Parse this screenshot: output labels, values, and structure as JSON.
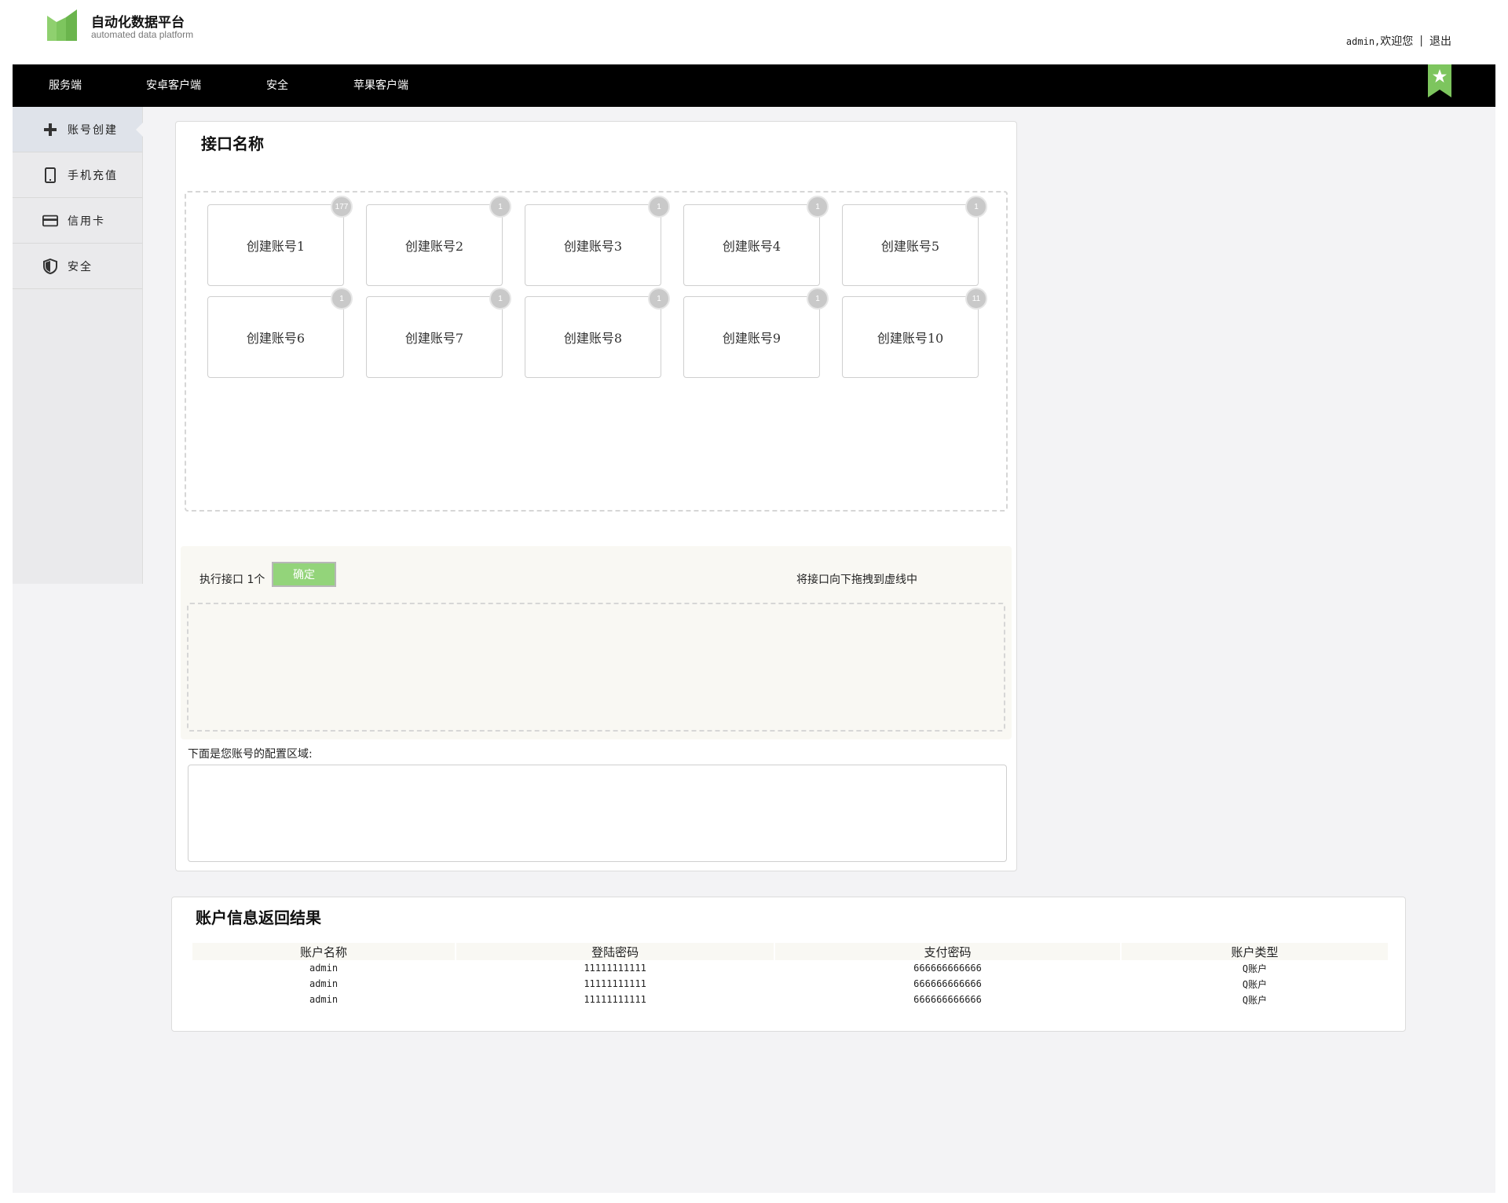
{
  "brand": {
    "title": "自动化数据平台",
    "subtitle": "automated data platform",
    "accent": "#7dc55e"
  },
  "user": {
    "name": "admin,",
    "welcome": "欢迎您",
    "separator": "|",
    "logout": "退出"
  },
  "nav": {
    "items": [
      "服务端",
      "安卓客户端",
      "安全",
      "苹果客户端"
    ],
    "bookmark_icon": "star-bookmark-icon"
  },
  "sidebar": {
    "items": [
      {
        "label": "账号创建",
        "icon": "plus-icon",
        "active": true
      },
      {
        "label": "手机充值",
        "icon": "phone-icon"
      },
      {
        "label": "信用卡",
        "icon": "credit-card-icon"
      },
      {
        "label": "安全",
        "icon": "shield-icon"
      }
    ]
  },
  "panel": {
    "title": "接口名称",
    "cards": [
      {
        "label": "创建账号1",
        "count": "177"
      },
      {
        "label": "创建账号2",
        "count": "1"
      },
      {
        "label": "创建账号3",
        "count": "1"
      },
      {
        "label": "创建账号4",
        "count": "1"
      },
      {
        "label": "创建账号5",
        "count": "1"
      },
      {
        "label": "创建账号6",
        "count": "1"
      },
      {
        "label": "创建账号7",
        "count": "1"
      },
      {
        "label": "创建账号8",
        "count": "1"
      },
      {
        "label": "创建账号9",
        "count": "1"
      },
      {
        "label": "创建账号10",
        "count": "11"
      }
    ],
    "exec_label": "执行接口 1个",
    "confirm": "确定",
    "hint": "将接口向下拖拽到虚线中",
    "config_label": "下面是您账号的配置区域:"
  },
  "results": {
    "title": "账户信息返回结果",
    "headers": [
      "账户名称",
      "登陆密码",
      "支付密码",
      "账户类型"
    ],
    "rows": [
      [
        "admin",
        "11111111111",
        "666666666666",
        "Q账户"
      ],
      [
        "admin",
        "11111111111",
        "666666666666",
        "Q账户"
      ],
      [
        "admin",
        "11111111111",
        "666666666666",
        "Q账户"
      ]
    ]
  }
}
